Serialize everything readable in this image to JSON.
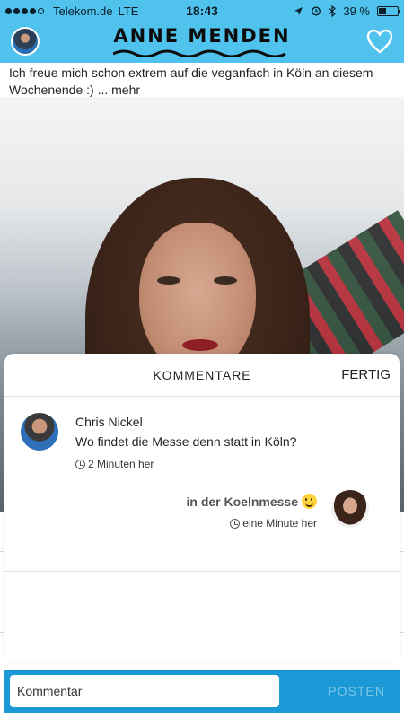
{
  "status_bar": {
    "carrier": "Telekom.de",
    "network": "LTE",
    "time": "18:43",
    "battery": "39 %",
    "battery_level": 0.39
  },
  "header": {
    "brand": "ANNE MENDEN",
    "background_color": "#4fc3ee"
  },
  "post": {
    "caption": "Ich freue mich schon extrem auf die veganfach in Köln an diesem Wochenende :) ... mehr"
  },
  "comments_sheet": {
    "title": "KOMMENTARE",
    "done_label": "FERTIG",
    "comments": [
      {
        "author": "Chris Nickel",
        "text": "Wo findet die Messe denn statt in Köln?",
        "time": "2 Minuten her"
      },
      {
        "text": "in der Koelnmesse",
        "time": "eine Minute her"
      }
    ]
  },
  "input_bar": {
    "placeholder": "Kommentar",
    "post_label": "POSTEN",
    "bar_color": "#1b98d6"
  }
}
